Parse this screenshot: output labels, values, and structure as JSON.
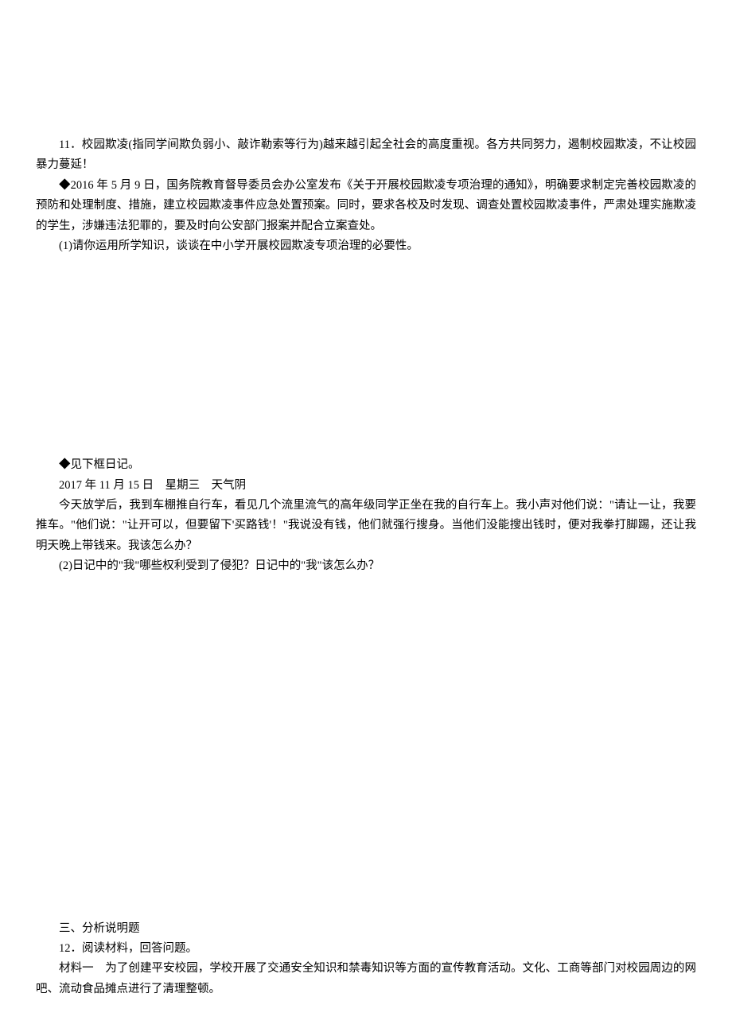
{
  "question11": {
    "intro": "11．校园欺凌(指同学间欺负弱小、敲诈勒索等行为)越来越引起全社会的高度重视。各方共同努力，遏制校园欺凌，不让校园暴力蔓延！",
    "policy": "◆2016 年 5 月 9 日，国务院教育督导委员会办公室发布《关于开展校园欺凌专项治理的通知》，明确要求制定完善校园欺凌的预防和处理制度、措施，建立校园欺凌事件应急处置预案。同时，要求各校及时发现、调查处置校园欺凌事件，严肃处理实施欺凌的学生，涉嫌违法犯罪的，要及时向公安部门报案并配合立案查处。",
    "sub1": "(1)请你运用所学知识，谈谈在中小学开展校园欺凌专项治理的必要性。",
    "diary_intro": "◆见下框日记。",
    "diary_date": "2017 年 11 月 15 日　星期三　天气阴",
    "diary_body": "今天放学后，我到车棚推自行车，看见几个流里流气的高年级同学正坐在我的自行车上。我小声对他们说：\"请让一让，我要推车。\"他们说：\"让开可以，但要留下'买路钱'！\"我说没有钱，他们就强行搜身。当他们没能搜出钱时，便对我拳打脚踢，还让我明天晚上带钱来。我该怎么办？",
    "sub2": "(2)日记中的\"我\"哪些权利受到了侵犯？日记中的\"我\"该怎么办？"
  },
  "section3": {
    "title": "三、分析说明题",
    "q12_intro": "12．阅读材料，回答问题。",
    "material1": "材料一　为了创建平安校园，学校开展了交通安全知识和禁毒知识等方面的宣传教育活动。文化、工商等部门对校园周边的网吧、流动食品摊点进行了清理整顿。"
  }
}
